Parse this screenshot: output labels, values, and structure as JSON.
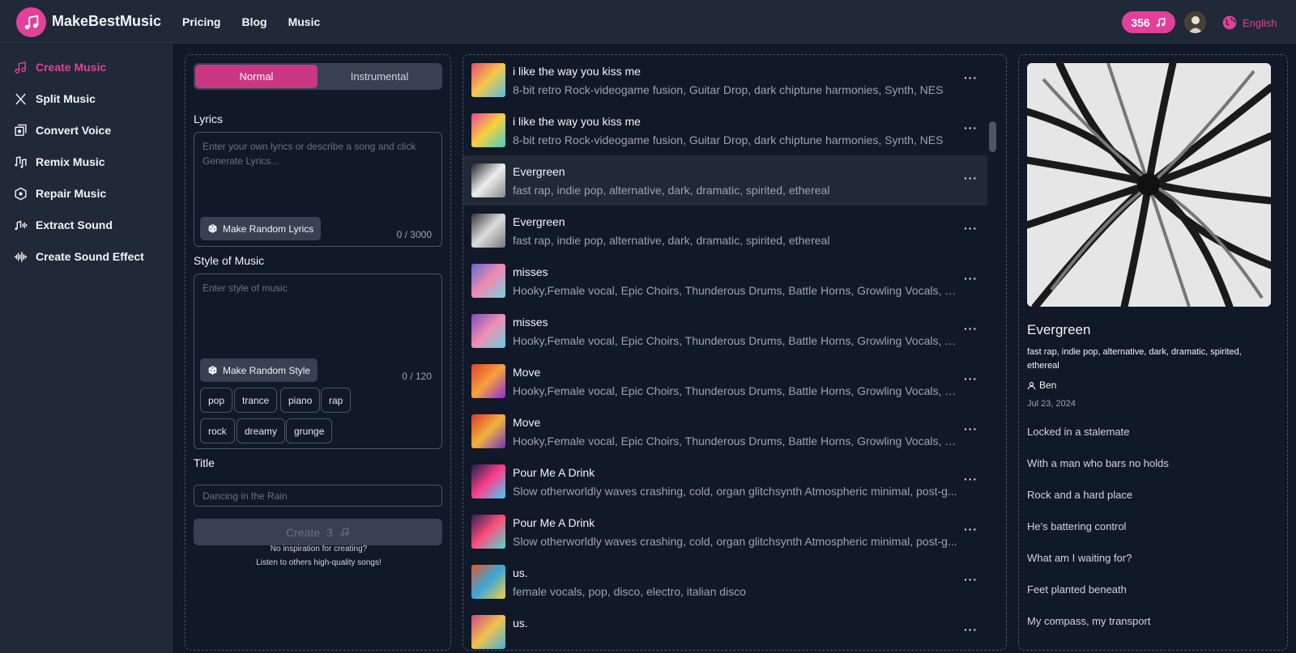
{
  "header": {
    "brand": "MakeBestMusic",
    "nav": [
      "Pricing",
      "Blog",
      "Music"
    ],
    "credits": "356",
    "language": "English"
  },
  "sidebar": {
    "items": [
      {
        "label": "Create Music",
        "icon": "music-notes-icon",
        "active": true
      },
      {
        "label": "Split Music",
        "icon": "split-icon",
        "active": false
      },
      {
        "label": "Convert Voice",
        "icon": "convert-voice-icon",
        "active": false
      },
      {
        "label": "Remix Music",
        "icon": "remix-icon",
        "active": false
      },
      {
        "label": "Repair Music",
        "icon": "repair-icon",
        "active": false
      },
      {
        "label": "Extract Sound",
        "icon": "extract-sound-icon",
        "active": false
      },
      {
        "label": "Create Sound Effect",
        "icon": "waveform-icon",
        "active": false
      }
    ]
  },
  "form": {
    "mode_normal": "Normal",
    "mode_instrumental": "Instrumental",
    "lyrics_label": "Lyrics",
    "lyrics_placeholder": "Enter your own lyrics or describe a song and click Generate Lyrics...",
    "random_lyrics": "Make Random Lyrics",
    "lyrics_count": "0 / 3000",
    "style_label": "Style of Music",
    "style_placeholder": "Enter style of music",
    "random_style": "Make Random Style",
    "style_count": "0 / 120",
    "style_chips": [
      "pop",
      "trance",
      "piano",
      "rap",
      "rock",
      "dreamy",
      "grunge"
    ],
    "title_label": "Title",
    "title_placeholder": "Dancing in the Rain",
    "create_label": "Create",
    "create_cost": "3",
    "hint_line1": "No inspiration for creating?",
    "hint_line2": "Listen to others high-quality songs!"
  },
  "songs": [
    {
      "title": "i like the way you kiss me",
      "tags": "8-bit retro Rock-videogame fusion, Guitar Drop, dark chiptune harmonies, Synth, NES",
      "selected": false
    },
    {
      "title": "i like the way you kiss me",
      "tags": "8-bit retro Rock-videogame fusion, Guitar Drop, dark chiptune harmonies, Synth, NES",
      "selected": false
    },
    {
      "title": "Evergreen",
      "tags": "fast rap, indie pop, alternative, dark, dramatic, spirited, ethereal",
      "selected": true
    },
    {
      "title": "Evergreen",
      "tags": "fast rap, indie pop, alternative, dark, dramatic, spirited, ethereal",
      "selected": false
    },
    {
      "title": "misses",
      "tags": "Hooky,Female vocal, Epic Choirs, Thunderous Drums, Battle Horns, Growling Vocals, Pa...",
      "selected": false
    },
    {
      "title": "misses",
      "tags": "Hooky,Female vocal, Epic Choirs, Thunderous Drums, Battle Horns, Growling Vocals, Pa...",
      "selected": false
    },
    {
      "title": "Move",
      "tags": "Hooky,Female vocal, Epic Choirs, Thunderous Drums, Battle Horns, Growling Vocals, Pa...",
      "selected": false
    },
    {
      "title": "Move",
      "tags": "Hooky,Female vocal, Epic Choirs, Thunderous Drums, Battle Horns, Growling Vocals, Pa...",
      "selected": false
    },
    {
      "title": "Pour Me A Drink",
      "tags": "Slow otherworldly waves crashing, cold, organ glitchsynth Atmospheric minimal, post-g...",
      "selected": false
    },
    {
      "title": "Pour Me A Drink",
      "tags": "Slow otherworldly waves crashing, cold, organ glitchsynth Atmospheric minimal, post-g...",
      "selected": false
    },
    {
      "title": "us.",
      "tags": "female vocals, pop, disco, electro, italian disco",
      "selected": false
    },
    {
      "title": "us.",
      "tags": "",
      "selected": false
    }
  ],
  "song_more": "···",
  "detail": {
    "title": "Evergreen",
    "tags": "fast rap, indie pop, alternative, dark, dramatic, spirited, ethereal",
    "user": "Ben",
    "date": "Jul 23, 2024",
    "lyrics": [
      "Locked in a stalemate",
      "With a man who bars no holds",
      "Rock and a hard place",
      "He's battering control",
      "What am I waiting for?",
      "Feet planted beneath",
      "My compass, my transport"
    ]
  },
  "colors": {
    "accent": "#e2409a",
    "bg": "#111827",
    "panel": "#1f2937"
  }
}
